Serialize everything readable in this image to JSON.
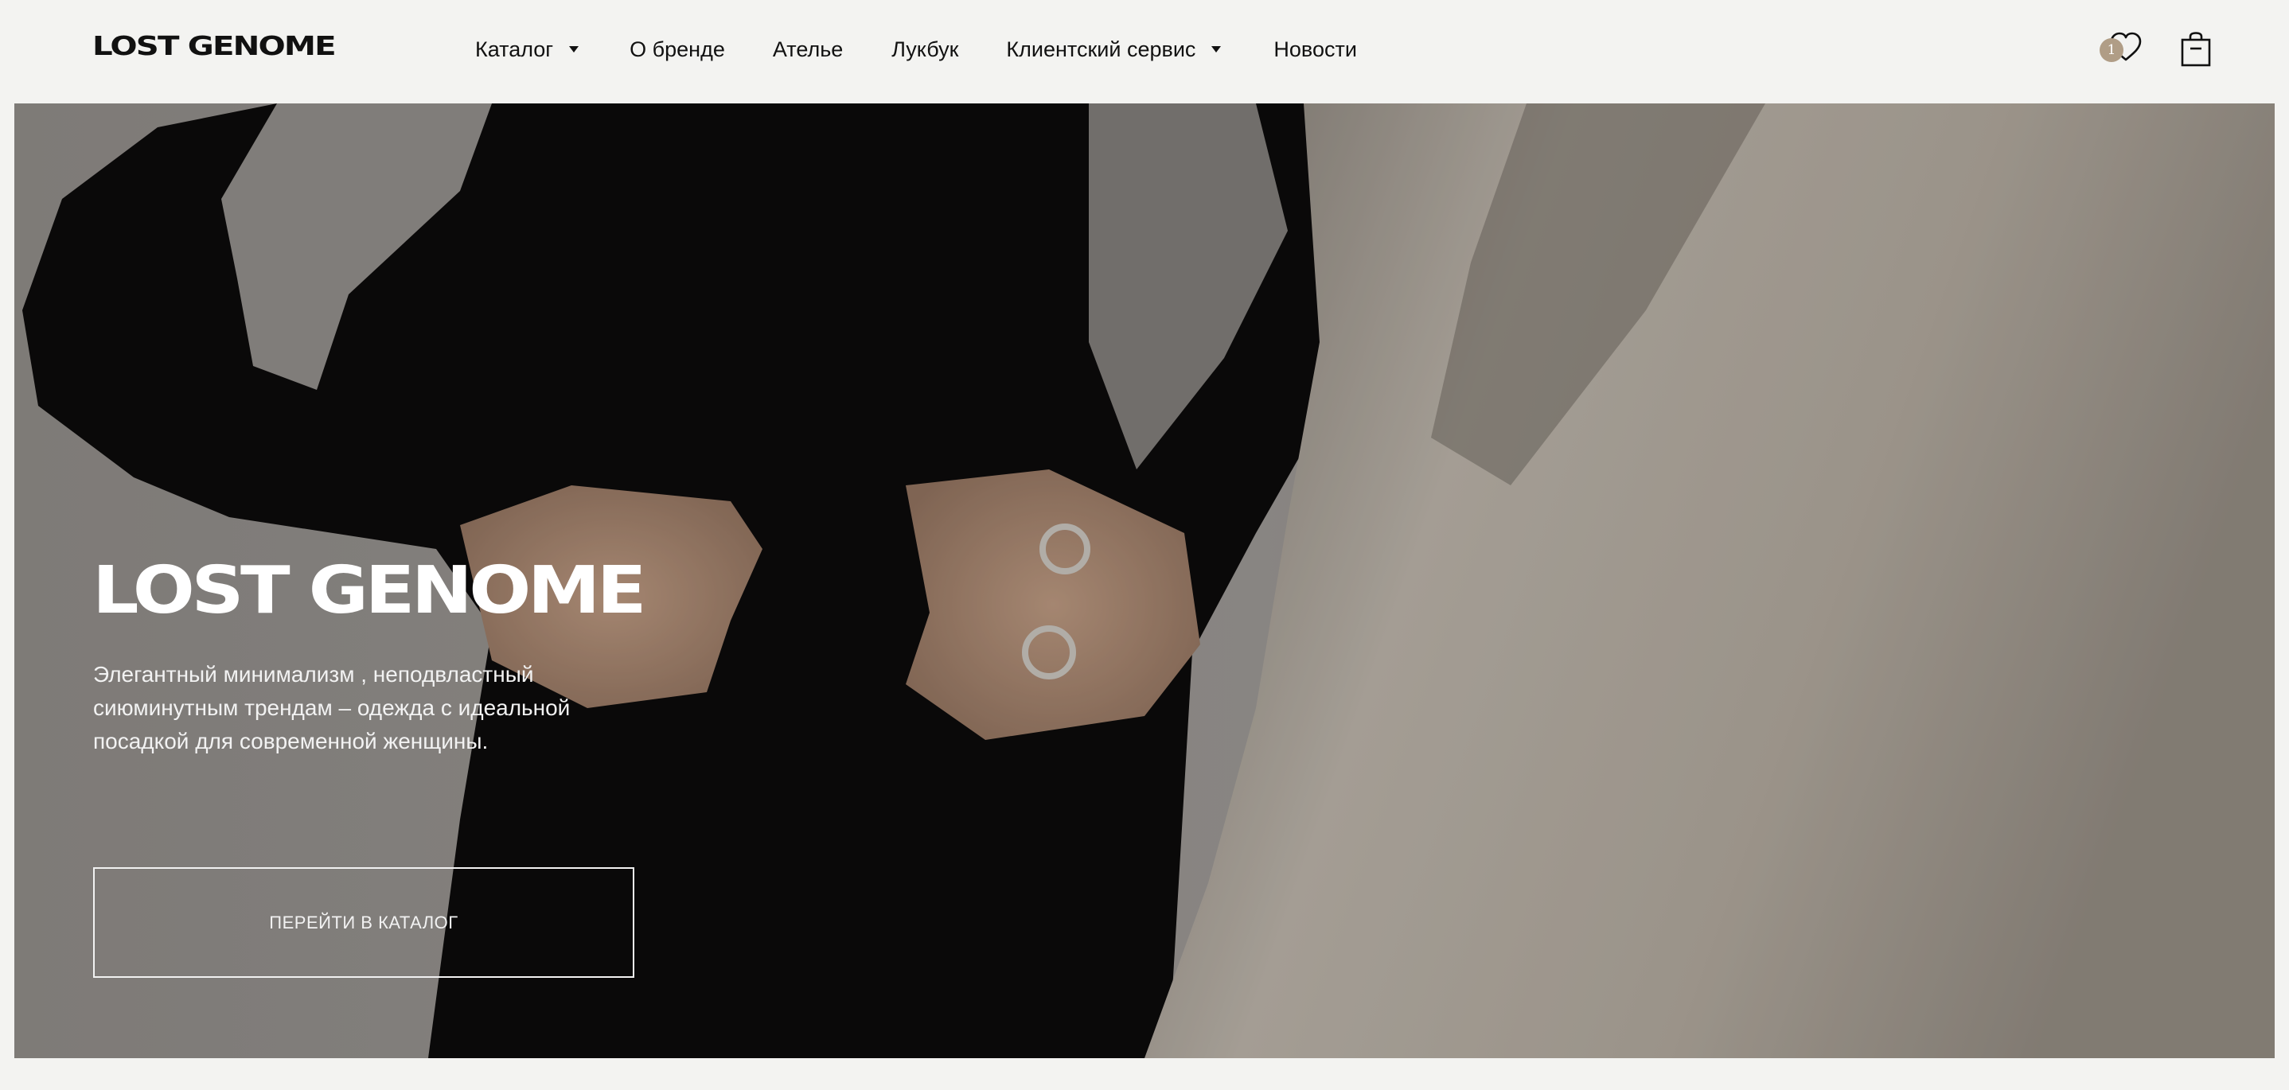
{
  "header": {
    "logo": "LOST GENOME",
    "nav": [
      {
        "label": "Каталог",
        "has_dropdown": true
      },
      {
        "label": "О бренде",
        "has_dropdown": false
      },
      {
        "label": "Ателье",
        "has_dropdown": false
      },
      {
        "label": "Лукбук",
        "has_dropdown": false
      },
      {
        "label": "Клиентский сервис",
        "has_dropdown": true
      },
      {
        "label": "Новости",
        "has_dropdown": false
      }
    ],
    "wishlist_count": "1",
    "icons": {
      "wishlist": "heart-icon",
      "cart": "shopping-bag-icon",
      "dropdown": "caret-down-icon"
    },
    "badge_color": "#b09d86"
  },
  "hero": {
    "title": "LOST GENOME",
    "description": "Элегантный минимализм , неподвластный сиюминутным трендам – одежда с идеальной посадкой для современной женщины.",
    "cta_label": "ПЕРЕЙТИ В КАТАЛОГ"
  }
}
